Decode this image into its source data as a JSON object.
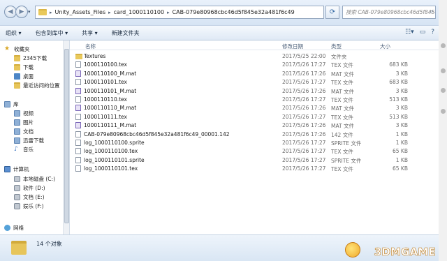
{
  "address": {
    "crumbs": [
      "Unity_Assets_Files",
      "card_1000110100",
      "CAB-079e80968cbc46d5f845e32a481f6c49"
    ],
    "search_placeholder": "搜索 CAB-079e80968cbc46d5f845e32a481f6c49"
  },
  "toolbar": {
    "organize": "组织 ▾",
    "include_library": "包含到库中 ▾",
    "share": "共享 ▾",
    "new_folder": "新建文件夹"
  },
  "navpane": {
    "favorites": "收藏夹",
    "fav_items": [
      "2345下载",
      "下载",
      "桌面",
      "最近访问的位置"
    ],
    "libraries": "库",
    "lib_items": [
      "视频",
      "图片",
      "文档",
      "迅雷下载",
      "音乐"
    ],
    "computer": "计算机",
    "drives": [
      "本地磁盘 (C:)",
      "软件 (D:)",
      "文档 (E:)",
      "娱乐 (F:)"
    ],
    "network": "网络"
  },
  "columns": {
    "name": "名称",
    "date": "修改日期",
    "type": "类型",
    "size": "大小"
  },
  "files": [
    {
      "name": "Textures",
      "date": "2017/5/25 22:00",
      "type": "文件夹",
      "size": "",
      "icon": "folder"
    },
    {
      "name": "1000110100.tex",
      "date": "2017/5/26 17:27",
      "type": "TEX 文件",
      "size": "683 KB",
      "icon": "file"
    },
    {
      "name": "1000110100_M.mat",
      "date": "2017/5/26 17:26",
      "type": "MAT 文件",
      "size": "3 KB",
      "icon": "mat"
    },
    {
      "name": "1000110101.tex",
      "date": "2017/5/26 17:27",
      "type": "TEX 文件",
      "size": "683 KB",
      "icon": "file"
    },
    {
      "name": "1000110101_M.mat",
      "date": "2017/5/26 17:26",
      "type": "MAT 文件",
      "size": "3 KB",
      "icon": "mat"
    },
    {
      "name": "1000110110.tex",
      "date": "2017/5/26 17:27",
      "type": "TEX 文件",
      "size": "513 KB",
      "icon": "file"
    },
    {
      "name": "1000110110_M.mat",
      "date": "2017/5/26 17:26",
      "type": "MAT 文件",
      "size": "3 KB",
      "icon": "mat"
    },
    {
      "name": "1000110111.tex",
      "date": "2017/5/26 17:27",
      "type": "TEX 文件",
      "size": "513 KB",
      "icon": "file"
    },
    {
      "name": "1000110111_M.mat",
      "date": "2017/5/26 17:26",
      "type": "MAT 文件",
      "size": "3 KB",
      "icon": "mat"
    },
    {
      "name": "CAB-079e80968cbc46d5f845e32a481f6c49_00001.142",
      "date": "2017/5/26 17:26",
      "type": "142 文件",
      "size": "1 KB",
      "icon": "file"
    },
    {
      "name": "log_1000110100.sprite",
      "date": "2017/5/26 17:27",
      "type": "SPRITE 文件",
      "size": "1 KB",
      "icon": "file"
    },
    {
      "name": "log_1000110100.tex",
      "date": "2017/5/26 17:27",
      "type": "TEX 文件",
      "size": "65 KB",
      "icon": "file"
    },
    {
      "name": "log_1000110101.sprite",
      "date": "2017/5/26 17:27",
      "type": "SPRITE 文件",
      "size": "1 KB",
      "icon": "file"
    },
    {
      "name": "log_1000110101.tex",
      "date": "2017/5/26 17:27",
      "type": "TEX 文件",
      "size": "65 KB",
      "icon": "file"
    }
  ],
  "status": {
    "count": "14 个对象"
  },
  "watermark": "3DMGAME"
}
